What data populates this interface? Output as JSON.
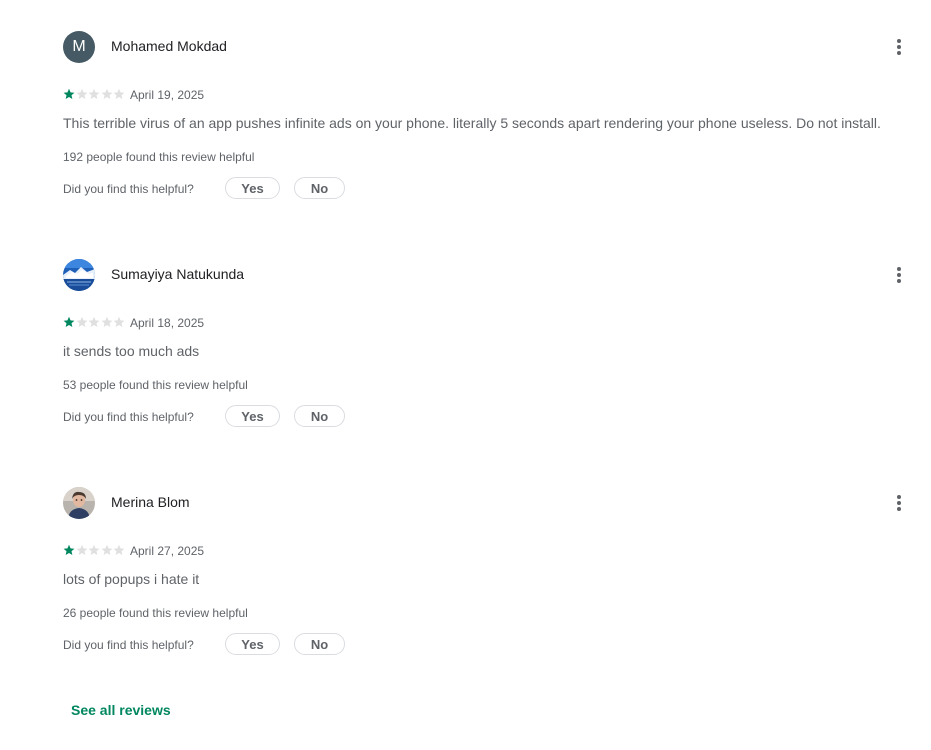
{
  "colors": {
    "star_filled": "#01875f",
    "star_empty": "#e0e0e0",
    "link": "#01875f",
    "avatar_letter_bg": "#455a64"
  },
  "icons": {
    "more": "more-vert-icon",
    "star": "star-icon"
  },
  "reviews": [
    {
      "author": "Mohamed Mokdad",
      "avatar_letter": "M",
      "rating": 1,
      "max_rating": 5,
      "date": "April 19, 2025",
      "text": "This terrible virus of an app pushes infinite ads on your phone. literally 5 seconds apart rendering your phone useless. Do not install.",
      "helpful_count_text": "192 people found this review helpful",
      "helpful_question": "Did you find this helpful?",
      "yes_label": "Yes",
      "no_label": "No"
    },
    {
      "author": "Sumayiya Natukunda",
      "avatar_letter": "",
      "rating": 1,
      "max_rating": 5,
      "date": "April 18, 2025",
      "text": "it sends too much ads",
      "helpful_count_text": "53 people found this review helpful",
      "helpful_question": "Did you find this helpful?",
      "yes_label": "Yes",
      "no_label": "No"
    },
    {
      "author": "Merina Blom",
      "avatar_letter": "",
      "rating": 1,
      "max_rating": 5,
      "date": "April 27, 2025",
      "text": "lots of popups i hate it",
      "helpful_count_text": "26 people found this review helpful",
      "helpful_question": "Did you find this helpful?",
      "yes_label": "Yes",
      "no_label": "No"
    }
  ],
  "see_all_label": "See all reviews"
}
